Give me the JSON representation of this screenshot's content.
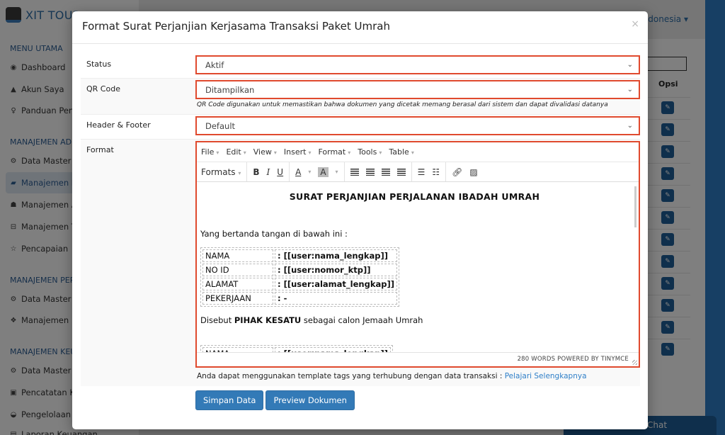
{
  "background": {
    "brand": "XIT TOUR",
    "language": "Indonesia ▾",
    "sidebar": {
      "sections": [
        {
          "label": "MENU UTAMA",
          "items": [
            {
              "icon": "globe-icon",
              "label": "Dashboard"
            },
            {
              "icon": "user-icon",
              "label": "Akun Saya"
            },
            {
              "icon": "lightbulb-icon",
              "label": "Panduan Pengguna"
            }
          ]
        },
        {
          "label": "MANAJEMEN ADMIN",
          "items": [
            {
              "icon": "gears-icon",
              "label": "Data Master & ..."
            },
            {
              "icon": "book-icon",
              "label": "Manajemen Paket",
              "active": true
            },
            {
              "icon": "users-icon",
              "label": "Manajemen Agen"
            },
            {
              "icon": "cart-icon",
              "label": "Manajemen Transaksi"
            },
            {
              "icon": "star-icon",
              "label": "Pencapaian"
            }
          ]
        },
        {
          "label": "MANAJEMEN PERJALANAN",
          "items": [
            {
              "icon": "gears-icon",
              "label": "Data Master & ..."
            },
            {
              "icon": "cubes-icon",
              "label": "Manajemen ..."
            }
          ]
        },
        {
          "label": "MANAJEMEN KEUANGAN",
          "items": [
            {
              "icon": "gears-icon",
              "label": "Data Master & ..."
            },
            {
              "icon": "money-icon",
              "label": "Pencatatan Keuangan"
            },
            {
              "icon": "inbox-icon",
              "label": "Pengelolaan Anggaran"
            },
            {
              "icon": "report-icon",
              "label": "Laporan Keuangan"
            }
          ]
        }
      ]
    },
    "table": {
      "options_header": "Opsi",
      "edit_rows": 12
    },
    "chat_label": "Chat"
  },
  "modal": {
    "title": "Format Surat Perjanjian Kerjasama Transaksi Paket Umrah",
    "close_icon": "×",
    "fields": {
      "status": {
        "label": "Status",
        "value": "Aktif"
      },
      "qr_code": {
        "label": "QR Code",
        "value": "Ditampilkan",
        "help": "QR Code digunakan untuk memastikan bahwa dokumen yang dicetak memang berasal dari sistem dan dapat divalidasi datanya"
      },
      "header_footer": {
        "label": "Header & Footer",
        "value": "Default"
      },
      "format": {
        "label": "Format"
      }
    },
    "editor": {
      "menus": [
        "File",
        "Edit",
        "View",
        "Insert",
        "Format",
        "Tools",
        "Table"
      ],
      "formats_label": "Formats",
      "toolbar": {
        "bold": "B",
        "italic": "I",
        "underline": "U",
        "font_color": "A",
        "bg_color": "A"
      },
      "content": {
        "title": "SURAT PERJANJIAN PERJALANAN IBADAH UMRAH",
        "intro": "Yang bertanda tangan di bawah ini :",
        "party1_rows": [
          {
            "key": "NAMA",
            "value": ": [[user:nama_lengkap]]"
          },
          {
            "key": "NO ID",
            "value": ": [[user:nomor_ktp]]"
          },
          {
            "key": "ALAMAT",
            "value": ": [[user:alamat_lengkap]]"
          },
          {
            "key": "PEKERJAAN",
            "value": ": -"
          }
        ],
        "party1_prefix": "Disebut ",
        "party1_bold": "PIHAK KESATU",
        "party1_suffix": " sebagai calon Jemaah Umrah",
        "party2_rows": [
          {
            "key": "NAMA",
            "value": ": [[user:nama_lengkap]]"
          }
        ]
      },
      "status_bar": "280 WORDS POWERED BY TINYMCE"
    },
    "hint": {
      "text": "Anda dapat menggunakan template tags yang terhubung dengan data transaksi : ",
      "link": "Pelajari Selengkapnya"
    },
    "buttons": {
      "save": "Simpan Data",
      "preview": "Preview Dokumen"
    }
  }
}
